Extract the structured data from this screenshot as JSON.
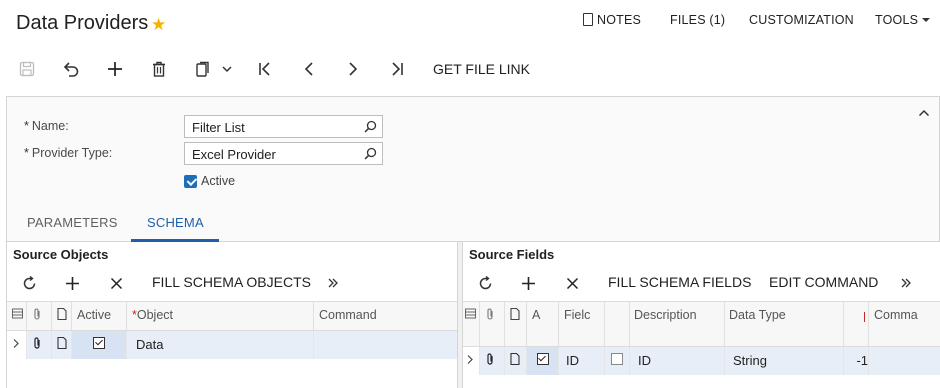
{
  "header": {
    "title": "Data Providers",
    "links": {
      "notes": "NOTES",
      "files": "FILES (1)",
      "customization": "CUSTOMIZATION",
      "tools": "TOOLS"
    }
  },
  "toolbar": {
    "icons": [
      "save-icon",
      "undo-icon",
      "add-icon",
      "delete-icon",
      "copy-paste-icon",
      "first-record-icon",
      "previous-record-icon",
      "next-record-icon",
      "last-record-icon"
    ],
    "get_file_link": "GET FILE LINK"
  },
  "form": {
    "name_label": "Name:",
    "name_value": "Filter List",
    "provider_type_label": "Provider Type:",
    "provider_type_value": "Excel Provider",
    "required_mark": "*",
    "active_label": "Active",
    "active_checked": true
  },
  "tabs": [
    {
      "label": "PARAMETERS",
      "active": false
    },
    {
      "label": "SCHEMA",
      "active": true
    }
  ],
  "source_objects": {
    "title": "Source Objects",
    "fill_button": "FILL SCHEMA OBJECTS",
    "columns": [
      "Active",
      "Object",
      "Command"
    ],
    "required_mark": "*",
    "rows": [
      {
        "active": true,
        "object": "Data",
        "command": ""
      }
    ]
  },
  "source_fields": {
    "title": "Source Fields",
    "fill_button": "FILL SCHEMA FIELDS",
    "edit_button": "EDIT COMMAND",
    "columns": [
      "A",
      "Fielc",
      "Description",
      "Data Type",
      "Comma"
    ],
    "rows": [
      {
        "active": true,
        "key": false,
        "field": "ID",
        "description": "ID",
        "data_type": "String",
        "length": "-1",
        "command": ""
      }
    ]
  },
  "colors": {
    "accent": "#1f5fa8",
    "star": "#f5b400",
    "selected_row": "#e7eef8"
  }
}
